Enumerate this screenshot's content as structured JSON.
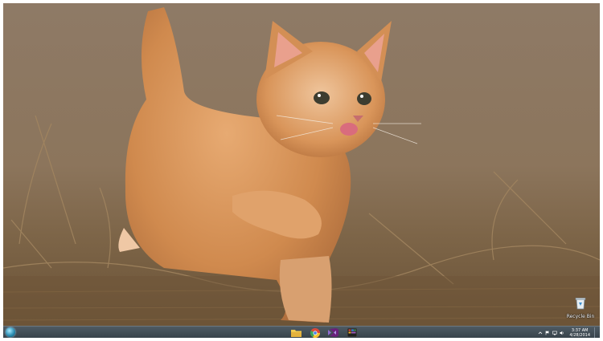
{
  "desktop": {
    "recycle_bin_label": "Recycle Bin",
    "wallpaper_subject": "orange-kitten-walking-in-dry-grass"
  },
  "taskbar": {
    "start_icon": "windows-orb-icon",
    "pinned": [
      {
        "name": "file-explorer",
        "icon": "folder-icon"
      },
      {
        "name": "chrome",
        "icon": "chrome-icon"
      },
      {
        "name": "visual-studio",
        "icon": "visual-studio-icon"
      },
      {
        "name": "start-app",
        "icon": "start-menu-app-icon",
        "label": "Start"
      }
    ],
    "tray_icons": [
      "show-hidden-icons-icon",
      "flag-icon",
      "network-icon",
      "volume-icon"
    ],
    "clock_time": "3:37 AM",
    "clock_date": "4/28/2014"
  },
  "colors": {
    "taskbar": "#3f4a52",
    "kitten_fur": "#d9955a",
    "background": "#8a7560"
  }
}
